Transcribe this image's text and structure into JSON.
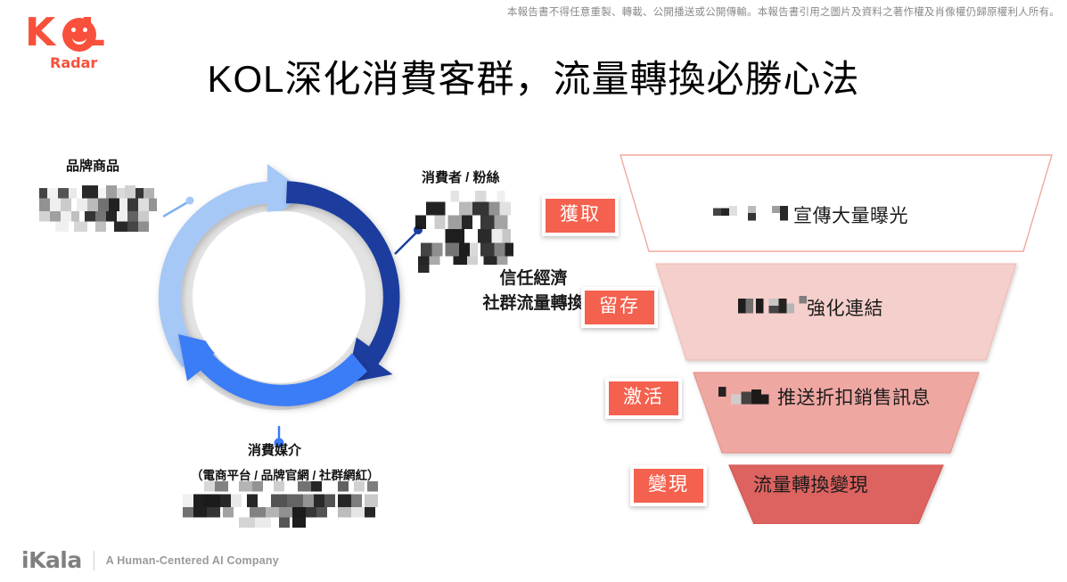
{
  "disclaimer": "本報告書不得任意重製、轉載、公開播送或公開傳輸。本報告書引用之圖片及資料之著作權及肖像權仍歸原權利人所有。",
  "brand": {
    "logo_word": "KOL",
    "logo_sub": "Radar",
    "logo_color": "#F9503C"
  },
  "title": "KOL深化消費客群，流量轉換必勝心法",
  "cycle": {
    "center_line1": "信任經濟",
    "center_line2": "社群流量轉換",
    "nodes": [
      {
        "label": "品牌商品",
        "redacted": true
      },
      {
        "label": "消費者 / 粉絲",
        "redacted": true
      },
      {
        "label": "消費媒介",
        "sublabel": "（電商平台 / 品牌官網 / 社群網紅）",
        "redacted": true
      }
    ],
    "arc_colors": {
      "top_left": "#A6C8F7",
      "right": "#1A3E9E",
      "bottom": "#3A7BF7",
      "track": "#E2E2E2"
    }
  },
  "funnel": {
    "stages": [
      {
        "badge": "獲取",
        "text": "宣傳大量曝光",
        "fill": "#FFFFFF",
        "stroke": "#F0A99E",
        "redacted_prefix": true
      },
      {
        "badge": "留存",
        "text": "強化連結",
        "fill": "#F5CFCB",
        "stroke": "#F0A99E",
        "redacted_prefix": true
      },
      {
        "badge": "激活",
        "text": "推送折扣銷售訊息",
        "fill": "#EFA7A2",
        "stroke": "#E08880",
        "redacted_prefix": true
      },
      {
        "badge": "變現",
        "text": "流量轉換變現",
        "fill": "#DD6360",
        "stroke": "#C9534F",
        "redacted_prefix": false
      }
    ],
    "badge_color": "#F4614E"
  },
  "footer": {
    "logo": "iKala",
    "tagline": "A Human-Centered AI Company"
  }
}
